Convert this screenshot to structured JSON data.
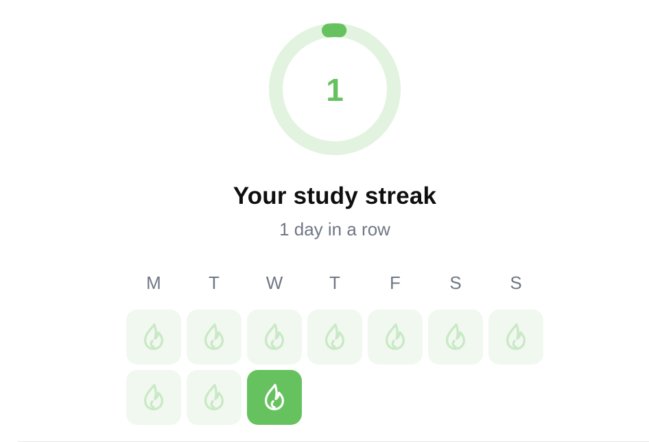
{
  "streak": {
    "count": "1",
    "progress": 0.03,
    "title": "Your study streak",
    "subtitle": "1 day in a row"
  },
  "weekdays": [
    "M",
    "T",
    "W",
    "T",
    "F",
    "S",
    "S"
  ],
  "days": [
    {
      "active": false
    },
    {
      "active": false
    },
    {
      "active": false
    },
    {
      "active": false
    },
    {
      "active": false
    },
    {
      "active": false
    },
    {
      "active": false
    },
    {
      "active": false
    },
    {
      "active": false
    },
    {
      "active": true
    }
  ],
  "icons": {
    "day": "flame-icon"
  },
  "colors": {
    "accent": "#66c25e",
    "ring_track": "#e2f3df",
    "cell_inactive": "#f0f8ef",
    "flame_inactive": "#c9e9c6",
    "title": "#0f0f10",
    "muted": "#6f7785"
  }
}
